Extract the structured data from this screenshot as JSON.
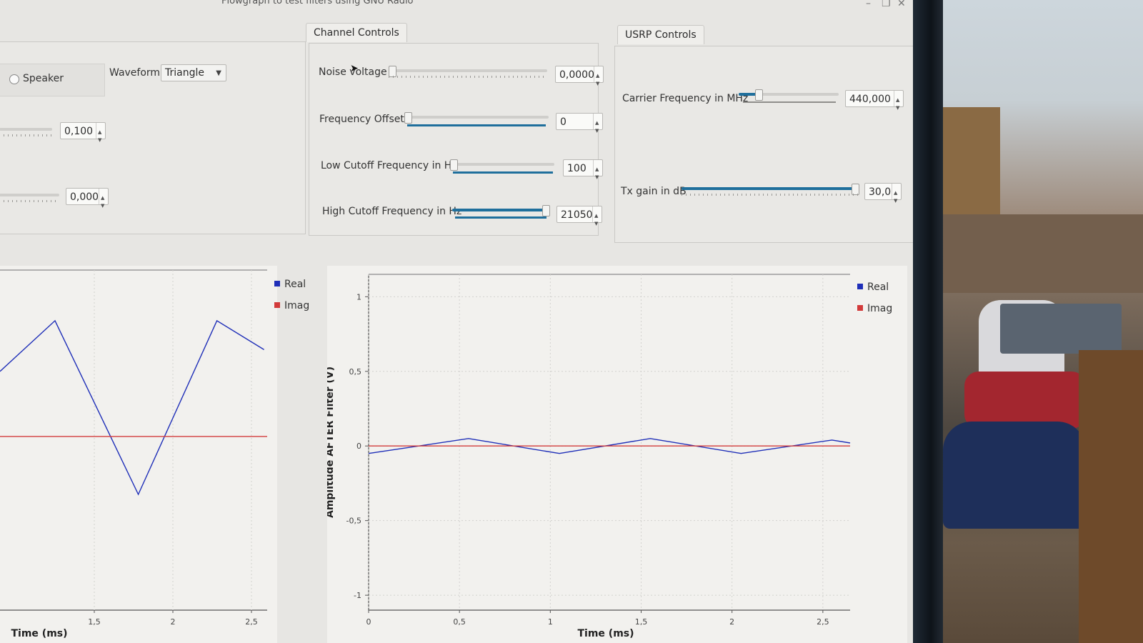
{
  "window": {
    "title": "Flowgraph to test filters using GNU Radio"
  },
  "source_panel": {
    "speaker_label": "Speaker",
    "waveform_label": "Waveform:",
    "waveform_value": "Triangle",
    "value_1": "0,100",
    "value_2": "0,000"
  },
  "channel_controls": {
    "tab": "Channel Controls",
    "noise_voltage": {
      "label": "Noise voltage",
      "value": "0,0000",
      "level": 0.0
    },
    "frequency_offset": {
      "label": "Frequency Offset",
      "value": "0",
      "level": 0.0
    },
    "low_cutoff": {
      "label": "Low Cutoff Frequency in Hz",
      "value": "100",
      "level": 0.02
    },
    "high_cutoff": {
      "label": "High Cutoff Frequency in Hz",
      "value": "21050",
      "level": 0.98
    }
  },
  "usrp_controls": {
    "tab": "USRP Controls",
    "carrier_frequency": {
      "label": "Carrier Frequency in MHz",
      "value": "440,000",
      "level": 0.2
    },
    "tx_gain": {
      "label": "Tx gain in dB",
      "value": "30,0",
      "level": 1.0
    }
  },
  "colors": {
    "real": "#1f2fb8",
    "imag": "#d23a3a",
    "accent": "#1f6f9c"
  },
  "chart_data": [
    {
      "type": "line",
      "xlabel": "Time (ms)",
      "ylabel": "",
      "xlim": [
        0.9,
        2.6
      ],
      "ylim": [
        -1.2,
        1.15
      ],
      "x_ticks": [
        "1,5",
        "2",
        "2,5"
      ],
      "legend": [
        "Real",
        "Imag"
      ],
      "series": [
        {
          "name": "Real",
          "x": [
            0.9,
            1.25,
            1.78,
            2.28,
            2.58
          ],
          "y": [
            0.45,
            0.8,
            -0.4,
            0.8,
            0.6
          ]
        },
        {
          "name": "Imag",
          "x": [
            0.9,
            2.6
          ],
          "y": [
            0.0,
            0.0
          ]
        }
      ]
    },
    {
      "type": "line",
      "xlabel": "Time (ms)",
      "ylabel": "Amplitude AFTER Filter (V)",
      "xlim": [
        0,
        2.65
      ],
      "ylim": [
        -1.1,
        1.15
      ],
      "x_ticks": [
        "0",
        "0,5",
        "1",
        "1,5",
        "2",
        "2,5"
      ],
      "y_ticks": [
        "1",
        "0,5",
        "0",
        "-0,5",
        "-1"
      ],
      "legend": [
        "Real",
        "Imag"
      ],
      "series": [
        {
          "name": "Real",
          "x": [
            0,
            0.55,
            1.05,
            1.55,
            2.05,
            2.55,
            2.65
          ],
          "y": [
            -0.05,
            0.05,
            -0.05,
            0.05,
            -0.05,
            0.04,
            0.02
          ]
        },
        {
          "name": "Imag",
          "x": [
            0,
            2.65
          ],
          "y": [
            0.0,
            0.0
          ]
        }
      ]
    }
  ]
}
